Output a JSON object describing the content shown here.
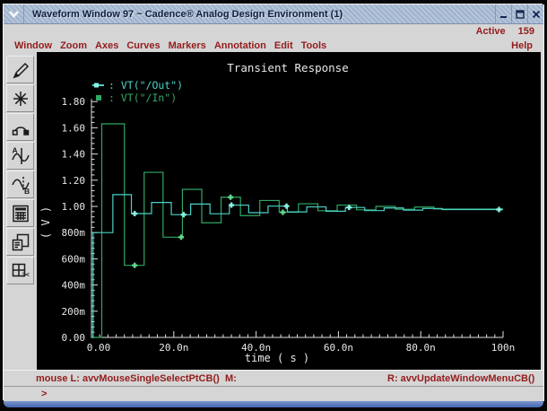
{
  "window": {
    "title": "Waveform Window 97 ~ Cadence® Analog Design Environment (1)",
    "active_label": "Active",
    "active_value": "159",
    "help_label": "Help"
  },
  "menus": [
    "Window",
    "Zoom",
    "Axes",
    "Curves",
    "Markers",
    "Annotation",
    "Edit",
    "Tools"
  ],
  "toolbar_icons": [
    "pen-icon",
    "starburst-icon",
    "arc-markers-icon",
    "vertical-marker-a-icon",
    "horizontal-marker-b-icon",
    "calculator-icon",
    "copy-window-icon",
    "cut-region-icon"
  ],
  "statusbar": {
    "left": "mouse L: avvMouseSingleSelectPtCB()",
    "middle": "M:",
    "right": "R: avvUpdateWindowMenuCB()"
  },
  "prompt": ">",
  "colors": {
    "menu_text": "#941c1c",
    "titlebar": "#a9bcd3",
    "plot_bg": "#000000",
    "plot_text": "#e8e8e8",
    "trace_out": "#4ad2c8",
    "trace_in": "#31a765",
    "marker_out": "#8df2e2",
    "marker_in": "#63d98c"
  },
  "chart_data": {
    "type": "line",
    "title": "Transient Response",
    "xlabel": "time ( s )",
    "ylabel": "( V )",
    "x_unit": "ns",
    "xlim": [
      0,
      100
    ],
    "ylim": [
      0,
      1.8
    ],
    "x_ticks": [
      "0.00",
      "20.0n",
      "40.0n",
      "60.0n",
      "80.0n",
      "100n"
    ],
    "y_ticks": [
      "0.00",
      "200m",
      "400m",
      "600m",
      "800m",
      "1.00",
      "1.20",
      "1.40",
      "1.60",
      "1.80"
    ],
    "grid": false,
    "legend_position": "top-left",
    "series": [
      {
        "name": "VT(\"/Out\")",
        "color": "#4ad2c8",
        "marker_color": "#8df2e2",
        "step": true,
        "points": [
          [
            0,
            0
          ],
          [
            0.4,
            0
          ],
          [
            0.4,
            0.8
          ],
          [
            5.2,
            0.8
          ],
          [
            5.2,
            1.09
          ],
          [
            9.7,
            1.09
          ],
          [
            9.7,
            0.945
          ],
          [
            14.6,
            0.945
          ],
          [
            14.6,
            1.03
          ],
          [
            19.4,
            1.03
          ],
          [
            19.4,
            0.937
          ],
          [
            24.1,
            0.937
          ],
          [
            24.1,
            1.018
          ],
          [
            28.8,
            1.018
          ],
          [
            28.8,
            0.944
          ],
          [
            33.5,
            0.944
          ],
          [
            33.5,
            1.01
          ],
          [
            38.2,
            1.01
          ],
          [
            38.2,
            0.952
          ],
          [
            42.9,
            0.952
          ],
          [
            42.9,
            1.002
          ],
          [
            47.6,
            1.002
          ],
          [
            47.6,
            0.958
          ],
          [
            52.3,
            0.958
          ],
          [
            52.3,
            0.996
          ],
          [
            57,
            0.996
          ],
          [
            57,
            0.963
          ],
          [
            61.7,
            0.963
          ],
          [
            61.7,
            0.992
          ],
          [
            66.4,
            0.992
          ],
          [
            66.4,
            0.968
          ],
          [
            71.1,
            0.968
          ],
          [
            71.1,
            0.988
          ],
          [
            75.8,
            0.988
          ],
          [
            75.8,
            0.972
          ],
          [
            80.5,
            0.972
          ],
          [
            80.5,
            0.984
          ],
          [
            85.2,
            0.984
          ],
          [
            85.2,
            0.976
          ],
          [
            100,
            0.976
          ]
        ],
        "marker_times": [
          10.5,
          22.4,
          34,
          47.4,
          62.6,
          99
        ]
      },
      {
        "name": "VT(\"/In\")",
        "color": "#31a765",
        "marker_color": "#63d98c",
        "step": true,
        "points": [
          [
            0,
            0
          ],
          [
            2.5,
            0
          ],
          [
            2.5,
            1.63
          ],
          [
            8,
            1.63
          ],
          [
            8,
            0.55
          ],
          [
            12.8,
            0.55
          ],
          [
            12.8,
            1.26
          ],
          [
            17.4,
            1.26
          ],
          [
            17.4,
            0.765
          ],
          [
            22.1,
            0.765
          ],
          [
            22.1,
            1.13
          ],
          [
            26.8,
            1.13
          ],
          [
            26.8,
            0.875
          ],
          [
            31.5,
            0.875
          ],
          [
            31.5,
            1.07
          ],
          [
            36.2,
            1.07
          ],
          [
            36.2,
            0.93
          ],
          [
            40.9,
            0.93
          ],
          [
            40.9,
            1.045
          ],
          [
            45.6,
            1.045
          ],
          [
            45.6,
            0.955
          ],
          [
            50.3,
            0.955
          ],
          [
            50.3,
            1.02
          ],
          [
            55,
            1.02
          ],
          [
            55,
            0.967
          ],
          [
            59.7,
            0.967
          ],
          [
            59.7,
            1.01
          ],
          [
            64.4,
            1.01
          ],
          [
            64.4,
            0.974
          ],
          [
            69.1,
            0.974
          ],
          [
            69.1,
            1.0
          ],
          [
            73.8,
            1.0
          ],
          [
            73.8,
            0.978
          ],
          [
            78.5,
            0.978
          ],
          [
            78.5,
            0.995
          ],
          [
            83.2,
            0.995
          ],
          [
            83.2,
            0.98
          ],
          [
            100,
            0.98
          ]
        ],
        "marker_times": [
          10.5,
          21.8,
          33.8,
          46.5
        ]
      }
    ]
  }
}
